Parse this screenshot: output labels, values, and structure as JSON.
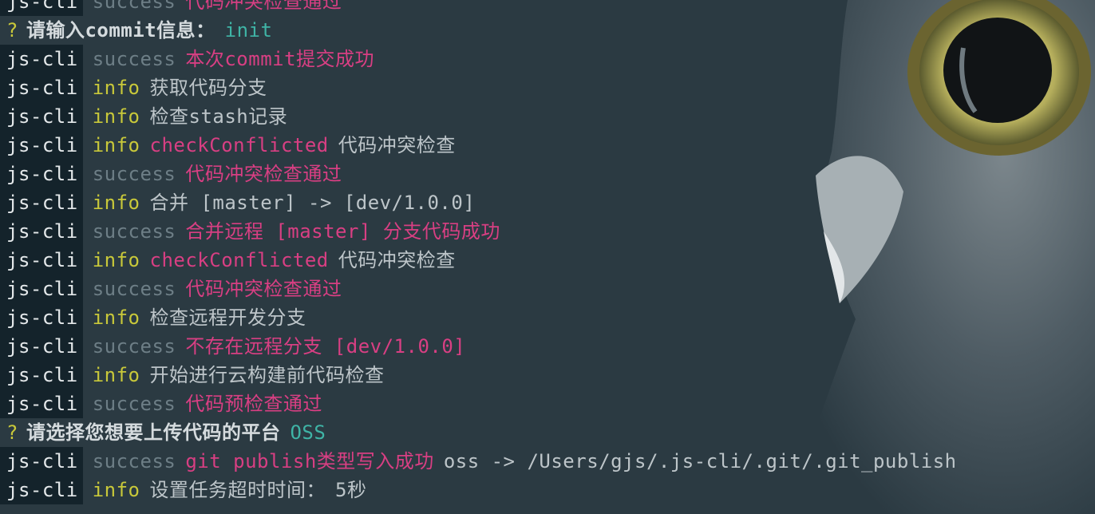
{
  "colors": {
    "background": "#2b3a42",
    "prefix_bg": "#14232b",
    "success": "#6d7e86",
    "info": "#c8c83a",
    "pink": "#d83f83",
    "plain": "#bdc5c9",
    "answer": "#3fb4a6"
  },
  "icons": {
    "background_image": "owl-photo"
  },
  "lines": [
    {
      "type": "log",
      "prefix": "js-cli",
      "level": "success",
      "message": "代码冲突检查通过",
      "message_style": "pink",
      "extra": ""
    },
    {
      "type": "question",
      "mark": "?",
      "text": "请输入commit信息：",
      "answer": "init"
    },
    {
      "type": "log",
      "prefix": "js-cli",
      "level": "success",
      "message": "本次commit提交成功",
      "message_style": "pink",
      "extra": ""
    },
    {
      "type": "log",
      "prefix": "js-cli",
      "level": "info",
      "message": "获取代码分支",
      "message_style": "plain",
      "extra": ""
    },
    {
      "type": "log",
      "prefix": "js-cli",
      "level": "info",
      "message": "检查stash记录",
      "message_style": "plain",
      "extra": ""
    },
    {
      "type": "log",
      "prefix": "js-cli",
      "level": "info",
      "message": "checkConflicted",
      "message_style": "pink",
      "extra": "代码冲突检查"
    },
    {
      "type": "log",
      "prefix": "js-cli",
      "level": "success",
      "message": "代码冲突检查通过",
      "message_style": "pink",
      "extra": ""
    },
    {
      "type": "log",
      "prefix": "js-cli",
      "level": "info",
      "message": "合并 [master] -> [dev/1.0.0]",
      "message_style": "plain",
      "extra": ""
    },
    {
      "type": "log",
      "prefix": "js-cli",
      "level": "success",
      "message": "合并远程 [master] 分支代码成功",
      "message_style": "pink",
      "extra": ""
    },
    {
      "type": "log",
      "prefix": "js-cli",
      "level": "info",
      "message": "checkConflicted",
      "message_style": "pink",
      "extra": "代码冲突检查"
    },
    {
      "type": "log",
      "prefix": "js-cli",
      "level": "success",
      "message": "代码冲突检查通过",
      "message_style": "pink",
      "extra": ""
    },
    {
      "type": "log",
      "prefix": "js-cli",
      "level": "info",
      "message": "检查远程开发分支",
      "message_style": "plain",
      "extra": ""
    },
    {
      "type": "log",
      "prefix": "js-cli",
      "level": "success",
      "message": "不存在远程分支 [dev/1.0.0]",
      "message_style": "pink",
      "extra": ""
    },
    {
      "type": "log",
      "prefix": "js-cli",
      "level": "info",
      "message": "开始进行云构建前代码检查",
      "message_style": "plain",
      "extra": ""
    },
    {
      "type": "log",
      "prefix": "js-cli",
      "level": "success",
      "message": "代码预检查通过",
      "message_style": "pink",
      "extra": ""
    },
    {
      "type": "question",
      "mark": "?",
      "text": "请选择您想要上传代码的平台",
      "answer": "OSS"
    },
    {
      "type": "log",
      "prefix": "js-cli",
      "level": "success",
      "message": "git publish类型写入成功",
      "message_style": "pink",
      "extra": "oss -> /Users/gjs/.js-cli/.git/.git_publish"
    },
    {
      "type": "log",
      "prefix": "js-cli",
      "level": "info",
      "message": "设置任务超时时间：",
      "message_style": "plain",
      "extra": "5秒"
    }
  ]
}
